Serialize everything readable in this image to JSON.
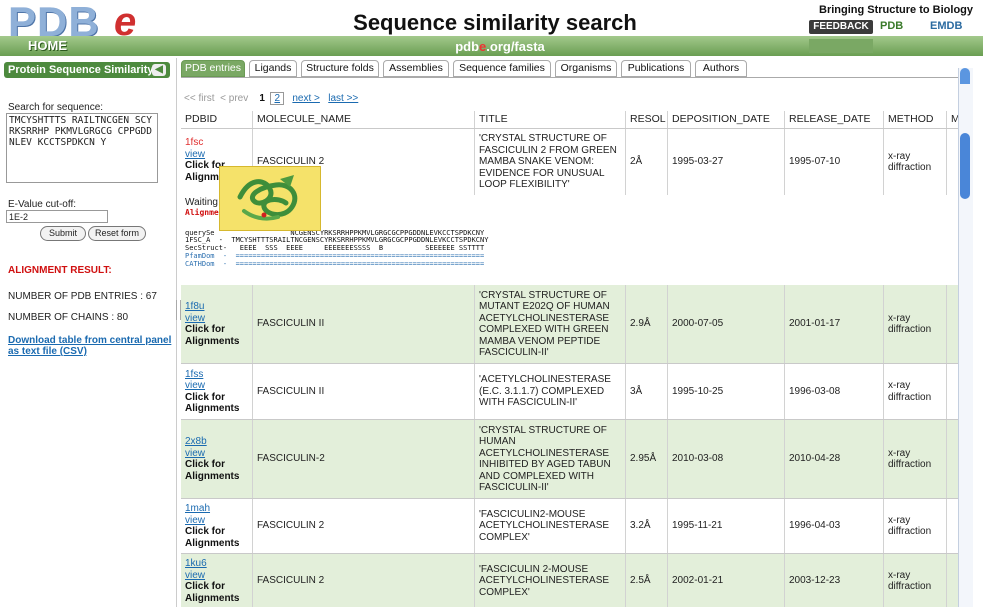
{
  "header": {
    "logo_text": "PDBe",
    "page_title": "Sequence similarity search",
    "tagline": "Bringing Structure to Biology",
    "feedback": "FEEDBACK",
    "partner_pdb": "PDB",
    "partner_emdb": "EMDB",
    "home": "HOME",
    "url_prefix": "pdb",
    "url_dot": "e",
    "url_suffix": ".org/fasta"
  },
  "sidebar": {
    "title": "Protein Sequence Similarity",
    "search_label": "Search for sequence:",
    "sequence": "TMCYSHTTTS RAILTNCGEN SCYRKSRRHP PKMVLGRGCG CPPGDDNLEV KCCTSPDKCN Y",
    "evalue_label": "E-Value cut-off:",
    "evalue": "1E-2",
    "submit": "Submit",
    "reset": "Reset form",
    "alignment_result": "ALIGNMENT RESULT:",
    "num_entries": "NUMBER OF PDB ENTRIES : 67",
    "num_chains": "NUMBER OF CHAINS : 80",
    "download": "Download table from central panel as text file (CSV)"
  },
  "tabs": [
    "PDB entries",
    "Ligands",
    "Structure folds",
    "Assemblies",
    "Sequence families",
    "Organisms",
    "Publications",
    "Authors"
  ],
  "pager": {
    "first": "<< first",
    "prev": "< prev",
    "page1": "1",
    "page2": "2",
    "next": "next >",
    "last": "last >>"
  },
  "table": {
    "headers": [
      "PDBID",
      "MOLECULE_NAME",
      "TITLE",
      "RESOL",
      "DEPOSITION_DATE",
      "RELEASE_DATE",
      "METHOD",
      "MA"
    ],
    "view": "view",
    "click": "Click for Alignments",
    "rows": [
      {
        "id": "1fsc",
        "molecule": "FASCICULIN 2",
        "title": "'CRYSTAL STRUCTURE OF FASCICULIN 2 FROM GREEN MAMBA SNAKE VENOM: EVIDENCE FOR UNUSUAL LOOP FLEXIBILITY'",
        "resol": "2Å",
        "dep": "1995-03-27",
        "rel": "1995-07-10",
        "method": "x-ray diffraction"
      },
      {
        "id": "1f8u",
        "molecule": "FASCICULIN II",
        "title": "'CRYSTAL STRUCTURE OF MUTANT E202Q OF HUMAN ACETYLCHOLINESTERASE COMPLEXED WITH GREEN MAMBA VENOM PEPTIDE FASCICULIN-II'",
        "resol": "2.9Å",
        "dep": "2000-07-05",
        "rel": "2001-01-17",
        "method": "x-ray diffraction"
      },
      {
        "id": "1fss",
        "molecule": "FASCICULIN II",
        "title": "'ACETYLCHOLINESTERASE (E.C. 3.1.1.7) COMPLEXED WITH FASCICULIN-II'",
        "resol": "3Å",
        "dep": "1995-10-25",
        "rel": "1996-03-08",
        "method": "x-ray diffraction"
      },
      {
        "id": "2x8b",
        "molecule": "FASCICULIN-2",
        "title": "'CRYSTAL STRUCTURE OF HUMAN ACETYLCHOLINESTERASE INHIBITED BY AGED TABUN AND COMPLEXED WITH FASCICULIN-II'",
        "resol": "2.95Å",
        "dep": "2010-03-08",
        "rel": "2010-04-28",
        "method": "x-ray diffraction"
      },
      {
        "id": "1mah",
        "molecule": "FASCICULIN 2",
        "title": "'FASCICULIN2-MOUSE ACETYLCHOLINESTERASE COMPLEX'",
        "resol": "3.2Å",
        "dep": "1995-11-21",
        "rel": "1996-04-03",
        "method": "x-ray diffraction"
      },
      {
        "id": "1ku6",
        "molecule": "FASCICULIN 2",
        "title": "'FASCICULIN 2-MOUSE ACETYLCHOLINESTERASE COMPLEX'",
        "resol": "2.5Å",
        "dep": "2002-01-21",
        "rel": "2003-12-23",
        "method": "x-ray diffraction"
      }
    ]
  },
  "alignment": {
    "waiting": "Waiting",
    "heading": "Alignme",
    "lines": [
      "querySe                  NCGENSCYRKSRRHPPKMVLGRGCGCPPGDDNLEVKCCTSPDKCNY",
      "1FSC_A  -  TMCYSHTTTSRAILTNCGENSCYRKSRRHPPKMVLGRGCGCPPGDDNLEVKCCTSPDKCNY",
      "SecStruct-   EEEE  SSS  EEEE     EEEEEEESSSS  B          SEEEEEE SSTTTT",
      "PfamDom  -  ===========================================================",
      "CATHDom  -  ==========================================================="
    ]
  }
}
